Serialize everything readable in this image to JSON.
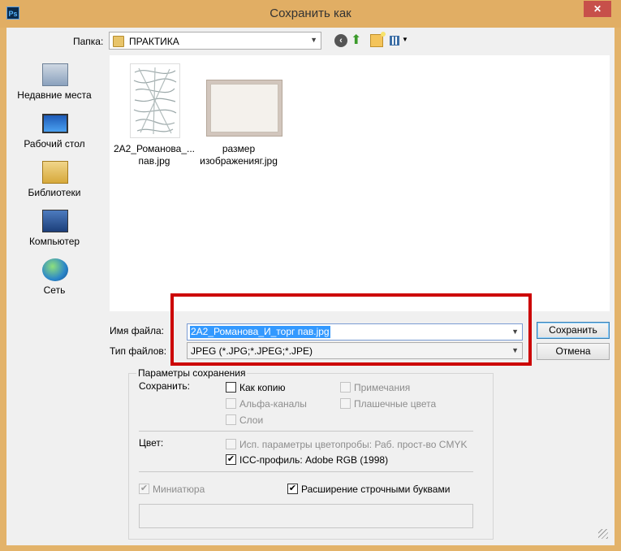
{
  "window": {
    "title": "Сохранить как",
    "app_icon": "Ps",
    "close_label": "✕"
  },
  "toolbar": {
    "folder_label": "Папка:",
    "folder_value": "ПРАКТИКА"
  },
  "places": [
    {
      "label": "Недавние места",
      "icon": "recent-places-icon"
    },
    {
      "label": "Рабочий стол",
      "icon": "desktop-icon"
    },
    {
      "label": "Библиотеки",
      "icon": "libraries-icon"
    },
    {
      "label": "Компьютер",
      "icon": "computer-icon"
    },
    {
      "label": "Сеть",
      "icon": "network-icon"
    }
  ],
  "files": [
    {
      "label_line1": "2А2_Романова_...",
      "label_line2": "пав.jpg"
    },
    {
      "label_line1": "размер",
      "label_line2": "изображенияг.jpg"
    }
  ],
  "form": {
    "filename_label": "Имя файла:",
    "filename_value": "2А2_Романова_И_торг пав.jpg",
    "filetype_label": "Тип файлов:",
    "filetype_value": "JPEG (*.JPG;*.JPEG;*.JPE)",
    "save_button": "Сохранить",
    "cancel_button": "Отмена"
  },
  "options": {
    "group_title": "Параметры сохранения",
    "save_label": "Сохранить:",
    "as_copy": "Как копию",
    "notes": "Примечания",
    "alpha": "Альфа-каналы",
    "spot": "Плашечные цвета",
    "layers": "Слои",
    "color_label": "Цвет:",
    "proof": "Исп. параметры цветопробы:  Раб. прост-во CMYK",
    "icc": "ICC-профиль:  Adobe RGB (1998)",
    "thumbnail": "Миниатюра",
    "lowercase_ext": "Расширение строчными буквами"
  }
}
